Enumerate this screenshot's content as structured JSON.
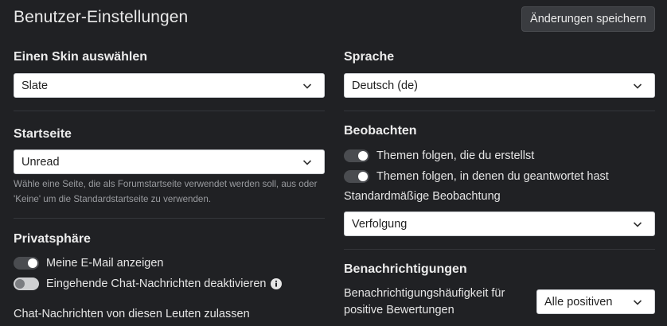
{
  "header": {
    "title": "Benutzer-Einstellungen",
    "save_label": "Änderungen speichern"
  },
  "skin": {
    "title": "Einen Skin auswählen",
    "value": "Slate"
  },
  "language": {
    "title": "Sprache",
    "value": "Deutsch (de)"
  },
  "homepage": {
    "title": "Startseite",
    "value": "Unread",
    "help": "Wähle eine Seite, die als Forumstartseite verwendet werden soll, aus oder 'Keine' um die Standardstartseite zu verwenden."
  },
  "watching": {
    "title": "Beobachten",
    "options": [
      {
        "label": "Themen folgen, die du erstellst",
        "on": true
      },
      {
        "label": "Themen folgen, in denen du geantwortet hast",
        "on": true
      }
    ],
    "default_label": "Standardmäßige Beobachtung",
    "default_value": "Verfolgung"
  },
  "privacy": {
    "title": "Privatsphäre",
    "options": [
      {
        "label": "Meine E-Mail anzeigen",
        "on": true
      },
      {
        "label": "Eingehende Chat-Nachrichten deaktivieren",
        "on": false
      }
    ],
    "chat_allow_label": "Chat-Nachrichten von diesen Leuten zulassen"
  },
  "notifications": {
    "title": "Benachrichtigungen",
    "frequency_label": "Benachrichtigungshäufigkeit für positive Bewertungen",
    "frequency_value": "Alle positiven"
  },
  "icons": {
    "chevron": "chevron-down-icon",
    "info": "info-icon"
  },
  "colors": {
    "background": "#202124",
    "toggle_on": "#4a4c50",
    "toggle_off": "#cfd0d2"
  }
}
